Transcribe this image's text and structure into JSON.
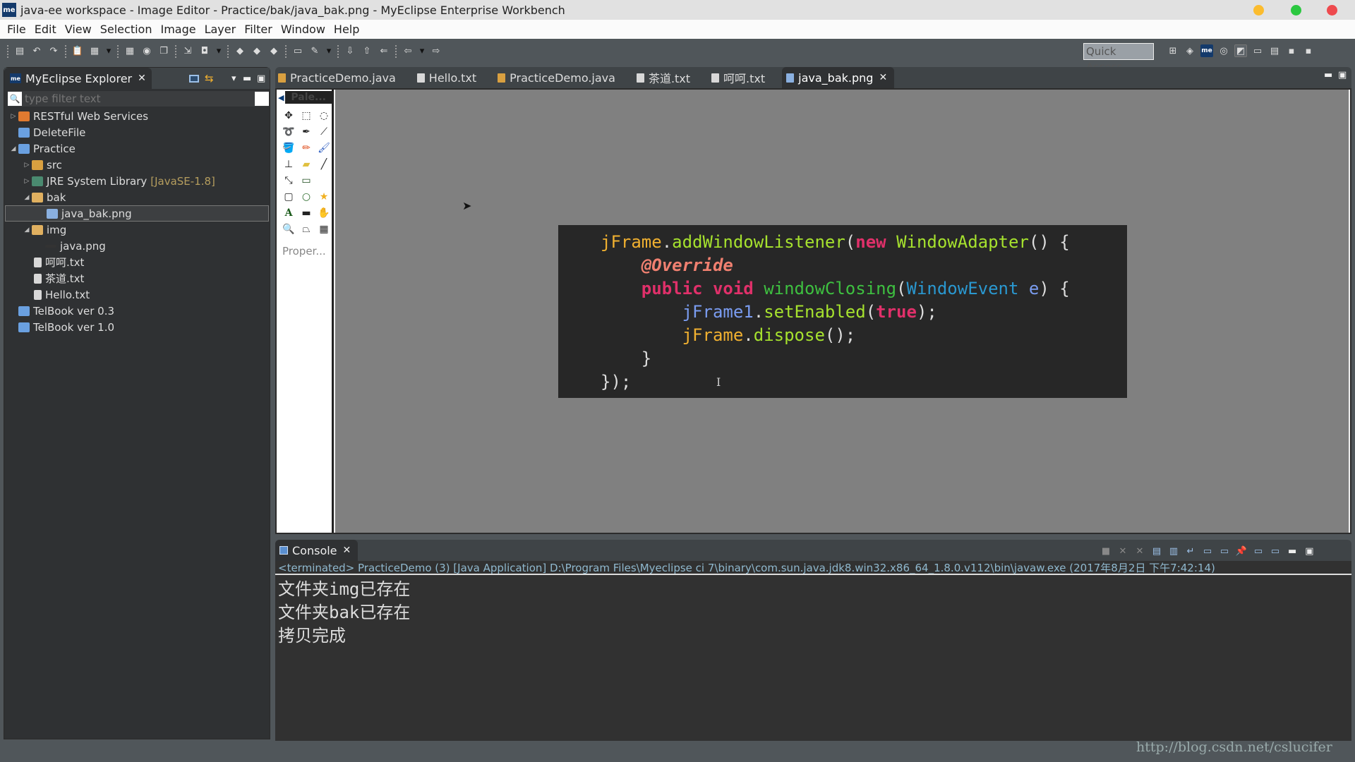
{
  "window": {
    "title": "java-ee workspace - Image Editor - Practice/bak/java_bak.png - MyEclipse Enterprise Workbench",
    "logo": "me",
    "controls": [
      {
        "name": "minimize",
        "color": "#fbbc2e"
      },
      {
        "name": "maximize",
        "color": "#2bc840"
      },
      {
        "name": "close",
        "color": "#ee4a4e"
      }
    ]
  },
  "menu": [
    "File",
    "Edit",
    "View",
    "Selection",
    "Image",
    "Layer",
    "Filter",
    "Window",
    "Help"
  ],
  "toolbar": {
    "quick_access": "Quick Access",
    "left_icons": [
      "new-icon",
      "undo-icon",
      "redo-icon",
      "paste-icon",
      "palette-icon",
      "dropdown-icon",
      "grid-icon",
      "globe-icon",
      "copy-icon",
      "export-icon",
      "camera-icon",
      "dropdown-icon",
      "layer-icon",
      "layer-icon",
      "layer-icon",
      "open-folder-icon",
      "brush-icon",
      "dropdown-icon",
      "download-icon",
      "upload-icon",
      "back-edit-icon",
      "back-icon",
      "dropdown-icon",
      "forward-icon"
    ],
    "right_icons": [
      "open-perspective-icon",
      "java-ee-perspective-icon",
      "myeclipse-icon",
      "debug-perspective-icon",
      "image-editor-perspective-icon",
      "new-window-icon",
      "new-view-icon",
      "save-icon",
      "save-all-icon"
    ]
  },
  "explorer": {
    "title": "MyEclipse Explorer",
    "filter_placeholder": "type filter text",
    "tree": [
      {
        "label": "RESTful Web Services",
        "level": 0,
        "twisty": "collapsed",
        "icon": "rest-icon"
      },
      {
        "label": "DeleteFile",
        "level": 0,
        "twisty": "none",
        "icon": "project-icon"
      },
      {
        "label": "Practice",
        "level": 0,
        "twisty": "expanded",
        "icon": "java-project-icon"
      },
      {
        "label": "src",
        "level": 1,
        "twisty": "collapsed",
        "icon": "source-folder-icon"
      },
      {
        "label": "JRE System Library",
        "decoration": "[JavaSE-1.8]",
        "level": 1,
        "twisty": "collapsed",
        "icon": "library-icon"
      },
      {
        "label": "bak",
        "level": 1,
        "twisty": "expanded",
        "icon": "folder-open-icon"
      },
      {
        "label": "java_bak.png",
        "level": 2,
        "twisty": "none",
        "icon": "image-file-icon",
        "selected": true
      },
      {
        "label": "img",
        "level": 1,
        "twisty": "expanded",
        "icon": "folder-open-icon"
      },
      {
        "label": "java.png",
        "level": 2,
        "twisty": "none",
        "icon": "image-thumb-icon"
      },
      {
        "label": "呵呵.txt",
        "level": 1,
        "twisty": "none",
        "icon": "text-file-icon"
      },
      {
        "label": "茶道.txt",
        "level": 1,
        "twisty": "none",
        "icon": "text-file-icon"
      },
      {
        "label": "Hello.txt",
        "level": 1,
        "twisty": "none",
        "icon": "text-file-icon"
      },
      {
        "label": "TelBook ver 0.3",
        "level": 0,
        "twisty": "none",
        "icon": "project-icon"
      },
      {
        "label": "TelBook ver 1.0",
        "level": 0,
        "twisty": "none",
        "icon": "project-icon"
      }
    ]
  },
  "editor": {
    "tabs": [
      {
        "label": "PracticeDemo.java",
        "icon": "java-file-icon"
      },
      {
        "label": "Hello.txt",
        "icon": "text-file-icon"
      },
      {
        "label": "PracticeDemo.java",
        "icon": "java-file-icon"
      },
      {
        "label": "茶道.txt",
        "icon": "text-file-icon"
      },
      {
        "label": "呵呵.txt",
        "icon": "text-file-icon"
      },
      {
        "label": "java_bak.png",
        "icon": "image-file-icon",
        "active": true
      }
    ],
    "palette": {
      "title": "Pale...",
      "tools": [
        "move-icon",
        "rect-select-icon",
        "ellipse-select-icon",
        "lasso-icon",
        "eyedropper-icon",
        "measure-icon",
        "fill-bucket-icon",
        "pencil-icon",
        "brush-icon",
        "stamp-icon",
        "eraser-icon",
        "line-icon",
        "arrow-icon",
        "rectangle-icon",
        "rounded-rect-icon",
        "ellipse-icon",
        "star-icon",
        "text-icon",
        "gradient-icon",
        "hand-icon",
        "zoom-icon",
        "perspective-icon",
        "mesh-icon"
      ],
      "properties": "Proper..."
    },
    "image_code": [
      [
        {
          "t": "jFrame",
          "c": "#f0b030"
        },
        {
          "t": ".",
          "c": "#ddd"
        },
        {
          "t": "addWindowListener",
          "c": "#a6e22e"
        },
        {
          "t": "(",
          "c": "#ddd"
        },
        {
          "t": "new",
          "c": "#e0306a"
        },
        {
          "t": " ",
          "c": "#ddd"
        },
        {
          "t": "WindowAdapter",
          "c": "#a6e22e"
        },
        {
          "t": "() {",
          "c": "#ddd"
        }
      ],
      [
        {
          "t": "    ",
          "c": "#ddd"
        },
        {
          "t": "@Override",
          "c": "#f08070",
          "i": true
        }
      ],
      [
        {
          "t": "    ",
          "c": "#ddd"
        },
        {
          "t": "public",
          "c": "#e0306a"
        },
        {
          "t": " ",
          "c": "#ddd"
        },
        {
          "t": "void",
          "c": "#e0306a"
        },
        {
          "t": " ",
          "c": "#ddd"
        },
        {
          "t": "windowClosing",
          "c": "#3ec040"
        },
        {
          "t": "(",
          "c": "#ddd"
        },
        {
          "t": "WindowEvent",
          "c": "#2a98d0"
        },
        {
          "t": " ",
          "c": "#ddd"
        },
        {
          "t": "e",
          "c": "#7a9cf0"
        },
        {
          "t": ") {",
          "c": "#ddd"
        }
      ],
      [
        {
          "t": "        ",
          "c": "#ddd"
        },
        {
          "t": "jFrame1",
          "c": "#7a9cf0"
        },
        {
          "t": ".",
          "c": "#ddd"
        },
        {
          "t": "setEnabled",
          "c": "#a6e22e"
        },
        {
          "t": "(",
          "c": "#ddd"
        },
        {
          "t": "true",
          "c": "#e0306a"
        },
        {
          "t": ");",
          "c": "#ddd"
        }
      ],
      [
        {
          "t": "        ",
          "c": "#ddd"
        },
        {
          "t": "jFrame",
          "c": "#f0b030"
        },
        {
          "t": ".",
          "c": "#ddd"
        },
        {
          "t": "dispose",
          "c": "#a6e22e"
        },
        {
          "t": "();",
          "c": "#ddd"
        }
      ],
      [
        {
          "t": "    }",
          "c": "#ddd"
        }
      ],
      [
        {
          "t": "});",
          "c": "#ddd"
        }
      ]
    ]
  },
  "console": {
    "title": "Console",
    "status": "<terminated> PracticeDemo (3) [Java Application] D:\\Program Files\\Myeclipse ci 7\\binary\\com.sun.java.jdk8.win32.x86_64_1.8.0.v112\\bin\\javaw.exe (2017年8月2日 下午7:42:14)",
    "lines": [
      "文件夹img已存在",
      "文件夹bak已存在",
      "拷贝完成"
    ],
    "toolbar_icons": [
      "terminate-icon",
      "remove-launch-icon",
      "remove-all-icon",
      "clear-console-icon",
      "scroll-lock-icon",
      "word-wrap-icon",
      "show-on-stdout-icon",
      "show-on-stderr-icon",
      "pin-console-icon",
      "display-console-icon",
      "new-console-icon"
    ]
  },
  "watermark": "http://blog.csdn.net/cslucifer"
}
